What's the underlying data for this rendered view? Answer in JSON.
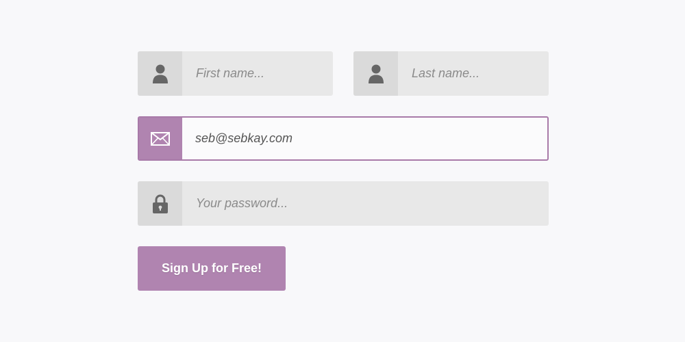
{
  "colors": {
    "accent": "#b084b0",
    "field_bg": "#e8e8e8",
    "icon_bg": "#dadada",
    "icon_fg": "#666666",
    "page_bg": "#f8f8fa"
  },
  "form": {
    "first_name": {
      "icon": "user-icon",
      "placeholder": "First name...",
      "value": ""
    },
    "last_name": {
      "icon": "user-icon",
      "placeholder": "Last name...",
      "value": ""
    },
    "email": {
      "icon": "envelope-icon",
      "placeholder": "",
      "value": "seb@sebkay.com"
    },
    "password": {
      "icon": "lock-icon",
      "placeholder": "Your password...",
      "value": ""
    },
    "submit_label": "Sign Up for Free!"
  }
}
